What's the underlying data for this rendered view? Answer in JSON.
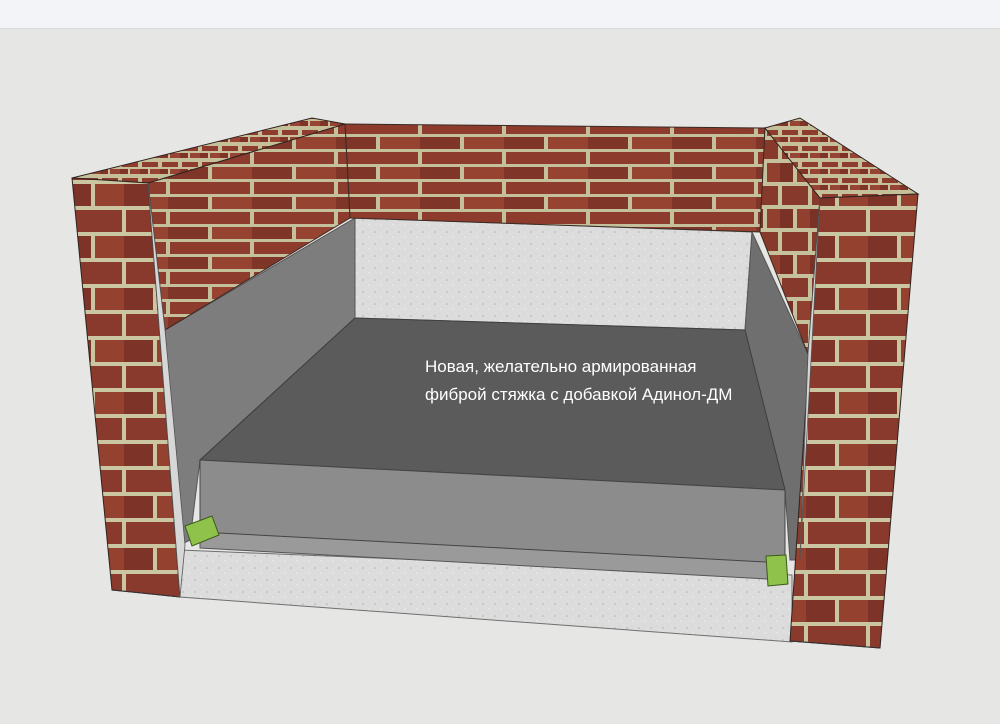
{
  "annotation": {
    "line1": "Новая, желательно армированная",
    "line2": "фиброй стяжка с добавкой Адинол-ДМ"
  },
  "colors": {
    "brick": "#8a3a2c",
    "mortar": "#c9c4a0",
    "concrete": "#dcdcdc",
    "screed_top": "#5b5b5b",
    "screed_side": "#8c8c8c",
    "spacer": "#8fc24a",
    "background": "#e6e6e4"
  },
  "icons": [
    "brick-wall",
    "concrete-base",
    "screed-slab",
    "spacer-block"
  ]
}
